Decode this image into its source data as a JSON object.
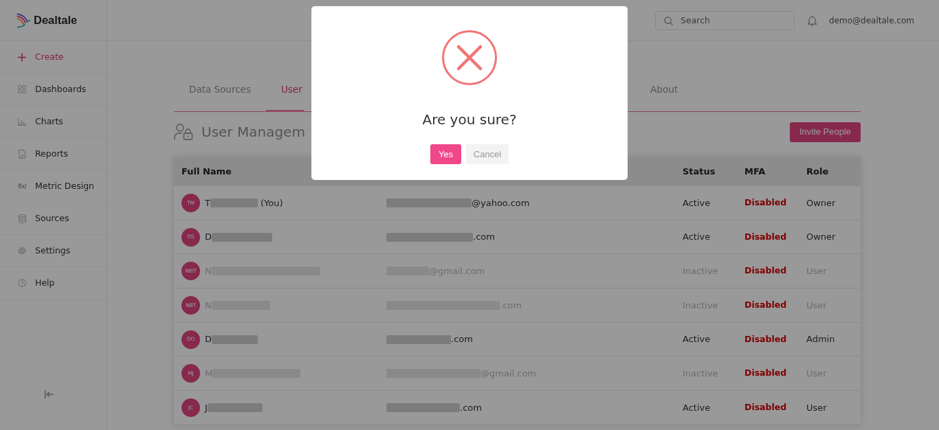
{
  "sidebar": {
    "logo": "Dealtale",
    "items": [
      {
        "label": "Create",
        "kind": "action"
      },
      {
        "label": "Dashboards",
        "kind": "link"
      },
      {
        "label": "Charts",
        "kind": "link"
      },
      {
        "label": "Reports",
        "kind": "link"
      },
      {
        "label": "Metric Design",
        "kind": "link",
        "symbol": "f(x)"
      },
      {
        "label": "Sources",
        "kind": "link"
      },
      {
        "label": "Settings",
        "kind": "link"
      },
      {
        "label": "Help",
        "kind": "link"
      }
    ]
  },
  "topbar": {
    "search": {
      "placeholder": "Search"
    },
    "user_email": "demo@dealtale.com"
  },
  "tabs": [
    {
      "label": "Data Sources",
      "selected": false
    },
    {
      "label": "User",
      "selected": true
    },
    {
      "label": "About",
      "selected": false
    }
  ],
  "page_title": "User Managem",
  "invite_button": "Invite People",
  "table": {
    "columns": {
      "name": "Full Name",
      "status": "Status",
      "mfa": "MFA",
      "role": "Role"
    },
    "rows": [
      {
        "initials": "TM",
        "name_start": "T",
        "name_suffix": "(You)",
        "email_end": "@yahoo.com",
        "status": "Active",
        "active": true,
        "mfa": "Disabled",
        "mfa_enabled": false,
        "role": "Owner"
      },
      {
        "initials": "DS",
        "name_start": "D",
        "email_end": ".com",
        "status": "Active",
        "active": true,
        "mfa": "Disabled",
        "mfa_enabled": false,
        "role": "Owner"
      },
      {
        "initials": "NBIT",
        "name_start": "N",
        "email_end": "@gmail.com",
        "status": "Inactive",
        "active": false,
        "mfa": "Disabled",
        "mfa_enabled": false,
        "role": "User"
      },
      {
        "initials": "NBT",
        "name_start": "N",
        "email_end": ".com",
        "status": "Inactive",
        "active": false,
        "mfa": "Disabled",
        "mfa_enabled": false,
        "role": "User"
      },
      {
        "initials": "DO",
        "name_start": "D",
        "email_end": ".com",
        "status": "Active",
        "active": true,
        "mfa": "Disabled",
        "mfa_enabled": false,
        "role": "Admin"
      },
      {
        "initials": "MJ",
        "name_start": "M",
        "email_end": "@gmail.com",
        "status": "Inactive",
        "active": false,
        "mfa": "Disabled",
        "mfa_enabled": false,
        "role": "User"
      },
      {
        "initials": "JC",
        "name_start": "J",
        "email_end": ".com",
        "status": "Active",
        "active": true,
        "mfa": "Disabled",
        "mfa_enabled": false,
        "role": "User"
      }
    ]
  },
  "dialog": {
    "title": "Are you sure?",
    "confirm": "Yes",
    "cancel": "Cancel"
  }
}
